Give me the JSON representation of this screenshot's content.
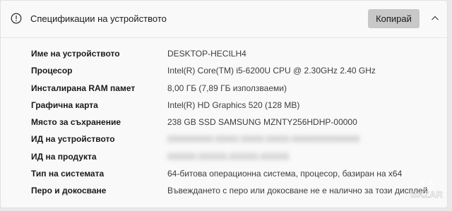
{
  "header": {
    "title": "Спецификации на устройството",
    "copy_label": "Копирай",
    "info_icon": "info-icon",
    "collapse_icon": "chevron-up-icon"
  },
  "specs": [
    {
      "label": "Име на устройството",
      "value": "DESKTOP-HECILH4",
      "blurred": false
    },
    {
      "label": "Процесор",
      "value": "Intel(R) Core(TM) i5-6200U CPU @ 2.30GHz   2.40 GHz",
      "blurred": false
    },
    {
      "label": "Инсталирана RAM памет",
      "value": "8,00 ГБ (7,89 ГБ използваеми)",
      "blurred": false
    },
    {
      "label": "Графична карта",
      "value": "Intel(R) HD Graphics 520 (128 MB)",
      "blurred": false
    },
    {
      "label": "Място за съхранение",
      "value": "238 GB SSD SAMSUNG MZNTY256HDHP-00000",
      "blurred": false
    },
    {
      "label": "ИД на устройството",
      "value": "",
      "blurred": true
    },
    {
      "label": "ИД на продукта",
      "value": "",
      "blurred": true
    },
    {
      "label": "Тип на системата",
      "value": "64-битова операционна система, процесор, базиран на x64",
      "blurred": false
    },
    {
      "label": "Перо и докосване",
      "value": "Въвеждането с перо или докосване не е налично за този дисплей",
      "blurred": false
    }
  ],
  "watermark": {
    "text": "BAZAR"
  }
}
